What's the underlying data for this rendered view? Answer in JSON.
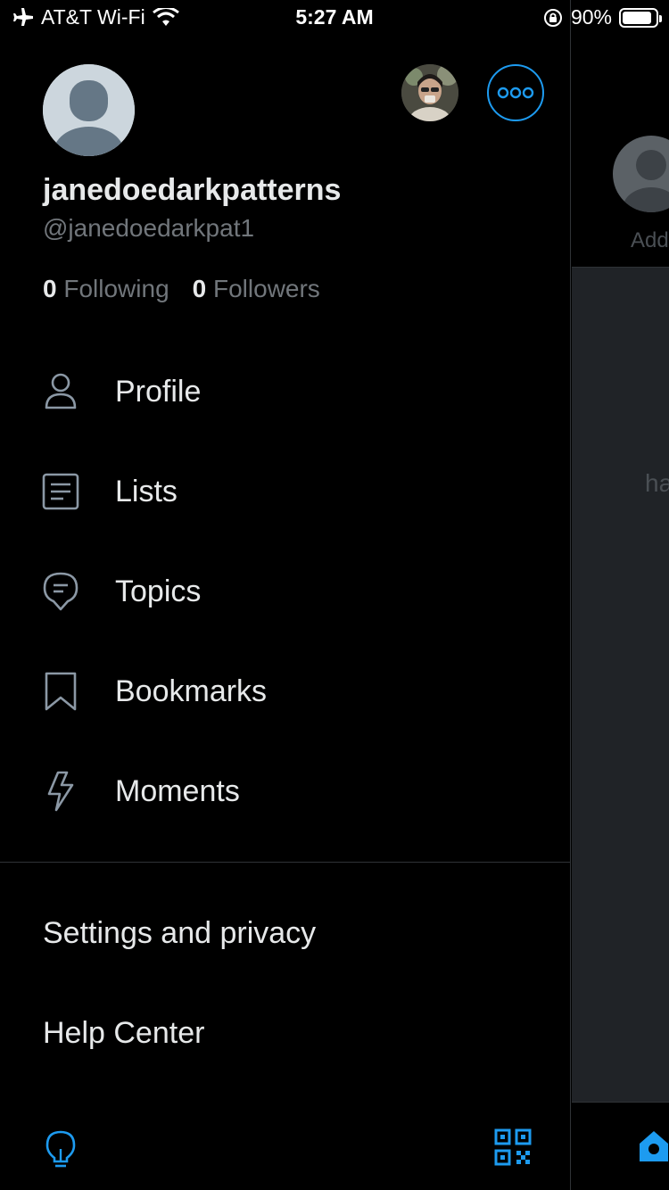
{
  "status_bar": {
    "carrier": "AT&T Wi-Fi",
    "time": "5:27 AM",
    "battery": "90%",
    "battery_level": 0.9
  },
  "profile": {
    "display_name": "janedoedarkpatterns",
    "handle": "@janedoedarkpat1",
    "following_count": "0",
    "following_label": "Following",
    "followers_count": "0",
    "followers_label": "Followers"
  },
  "menu": {
    "items": [
      {
        "label": "Profile",
        "icon": "person-icon"
      },
      {
        "label": "Lists",
        "icon": "list-icon"
      },
      {
        "label": "Topics",
        "icon": "topics-icon"
      },
      {
        "label": "Bookmarks",
        "icon": "bookmark-icon"
      },
      {
        "label": "Moments",
        "icon": "lightning-icon"
      }
    ]
  },
  "secondary": {
    "settings": "Settings and privacy",
    "help": "Help Center"
  },
  "peek": {
    "add_text": "Add",
    "ha_text": "ha"
  },
  "colors": {
    "accent": "#1d9bf0",
    "background": "#000000",
    "text": "#e7e9ea",
    "muted": "#71767b"
  }
}
